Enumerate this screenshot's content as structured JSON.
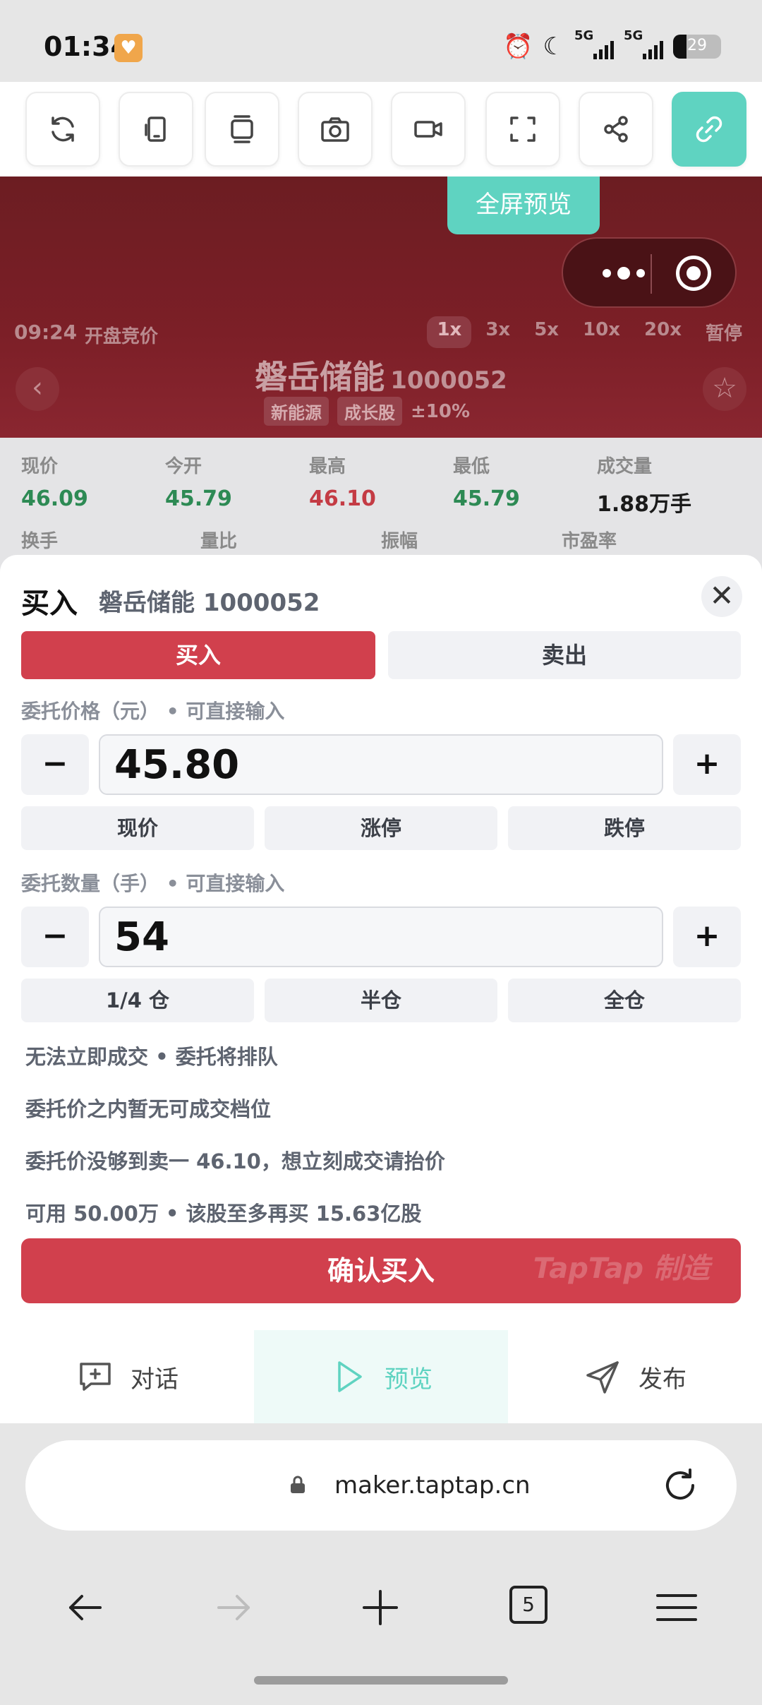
{
  "status_bar": {
    "time": "01:34",
    "signal1_label": "5G",
    "signal2_label": "5G",
    "battery": "29"
  },
  "toolbar": {
    "items": [
      "refresh-icon",
      "rotate-icon",
      "layers-icon",
      "camera-icon",
      "video-icon",
      "fullscreen-icon",
      "share-icon",
      "link-icon"
    ]
  },
  "game": {
    "fullscreen_preview": "全屏预览",
    "phase_time": "09:24",
    "phase_label": "开盘竞价",
    "speeds": [
      "1x",
      "3x",
      "5x",
      "10x",
      "20x",
      "暂停"
    ],
    "active_speed": "1x",
    "stock_name": "磐岳储能",
    "stock_code": "1000052",
    "tags": [
      "新能源",
      "成长股"
    ],
    "limit": "±10%",
    "quotes": [
      {
        "label": "现价",
        "value": "46.09",
        "color": "#2d8a54"
      },
      {
        "label": "今开",
        "value": "45.79",
        "color": "#2d8a54"
      },
      {
        "label": "最高",
        "value": "46.10",
        "color": "#c43b44"
      },
      {
        "label": "最低",
        "value": "45.79",
        "color": "#2d8a54"
      },
      {
        "label": "成交量",
        "value": "1.88万手",
        "color": "#1a1a1a"
      }
    ],
    "quotes_row2": [
      "换手",
      "量比",
      "振幅",
      "市盈率"
    ]
  },
  "sheet": {
    "title": "买入",
    "subtitle": "磐岳储能 1000052",
    "close": "✕",
    "buy_tab": "买入",
    "sell_tab": "卖出",
    "price_label": "委托价格（元） • 可直接输入",
    "price_value": "45.80",
    "minus": "−",
    "plus": "+",
    "price_quick": [
      "现价",
      "涨停",
      "跌停"
    ],
    "qty_label": "委托数量（手） • 可直接输入",
    "qty_value": "54",
    "qty_quick": [
      "1/4 仓",
      "半仓",
      "全仓"
    ],
    "info_lines": [
      "无法立即成交 • 委托将排队",
      "委托价之内暂无可成交档位",
      "委托价没够到卖一 46.10，想立刻成交请抬价",
      "可用 50.00万 • 该股至多再买 15.63亿股"
    ],
    "confirm": "确认买入",
    "watermark": "TapTap 制造"
  },
  "tabs": [
    {
      "label": "对话",
      "icon": "chat-plus-icon"
    },
    {
      "label": "预览",
      "icon": "play-icon"
    },
    {
      "label": "发布",
      "icon": "send-icon"
    }
  ],
  "browser": {
    "url": "maker.taptap.cn",
    "tab_count": "5"
  },
  "colors": {
    "accent": "#5fd3c1",
    "buy_red": "#d1404d",
    "header_red": "#7c1f27"
  }
}
